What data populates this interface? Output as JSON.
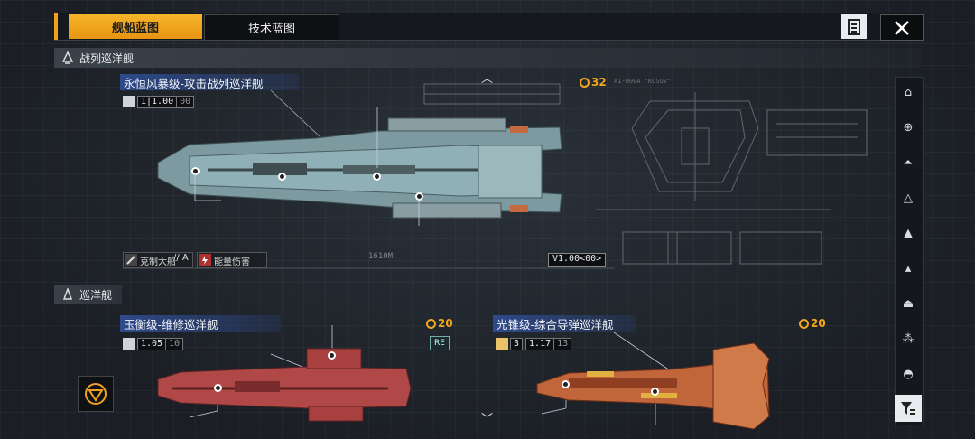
{
  "tabs": {
    "ship_blueprints": "舰船蓝图",
    "tech_blueprints": "技术蓝图"
  },
  "sections": {
    "battlecruiser": "战列巡洋舰",
    "cruiser": "巡洋舰"
  },
  "ships": [
    {
      "title": "永恒风暴级-攻击战列巡洋舰",
      "stat_value": "1|1.00",
      "stat_suffix": "00",
      "cost": "32",
      "tags": [
        "克制大船",
        "// A",
        "能量伤害"
      ],
      "version": "V1.00<00>",
      "length_label": "1610M",
      "hull_color": "#7c9aa0"
    },
    {
      "title": "玉衡级-维修巡洋舰",
      "stat_value": "1.05",
      "stat_suffix": "10",
      "cost": "20",
      "badge": "RE",
      "hull_color": "#b14848"
    },
    {
      "title": "光锥级-综合导弹巡洋舰",
      "stat_level": "3",
      "stat_value": "1.17",
      "stat_suffix": "13",
      "cost": "20",
      "hull_color": "#c0663a"
    }
  ],
  "blueprint_label": "AI-000A \"KOSOV\"",
  "colors": {
    "accent": "#f0a020",
    "cost": "#f2a51f",
    "title_bg": "#2e4a8c"
  },
  "icons": {
    "document": "document-icon",
    "close": "close-icon",
    "filter": "filter-icon",
    "scroll_up": "chevron-up-icon",
    "scroll_down": "chevron-down-icon"
  },
  "rail_items": [
    "hangar-icon",
    "carrier-icon",
    "battlecruiser-icon",
    "cruiser-icon",
    "destroyer-icon",
    "frigate-icon",
    "corvette-icon",
    "fighter-icon",
    "station-icon"
  ]
}
